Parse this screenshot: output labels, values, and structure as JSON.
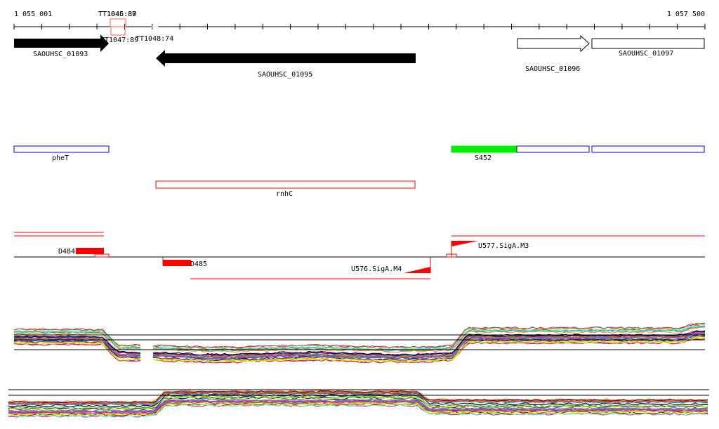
{
  "ruler": {
    "start": "1 055 001",
    "end": "1 057 500"
  },
  "terminators": [
    "TT1045:80",
    "TT1046:87",
    "TT1047:89",
    "TT1048:74"
  ],
  "genes": [
    "SAOUHSC_01093",
    "SAOUHSC_01095",
    "SAOUHSC_01096",
    "SAOUHSC_01097"
  ],
  "features": [
    "pheT",
    "S452",
    "rnhC"
  ],
  "promoters": [
    "D484",
    "D485",
    "U576.SigA.M4",
    "U577.SigA.M3"
  ],
  "colors": {
    "gene": "#000000",
    "feature": "#0000cc",
    "rna": "#ff0000",
    "expressed": "#00ff00",
    "terminator": "#ff6040"
  }
}
